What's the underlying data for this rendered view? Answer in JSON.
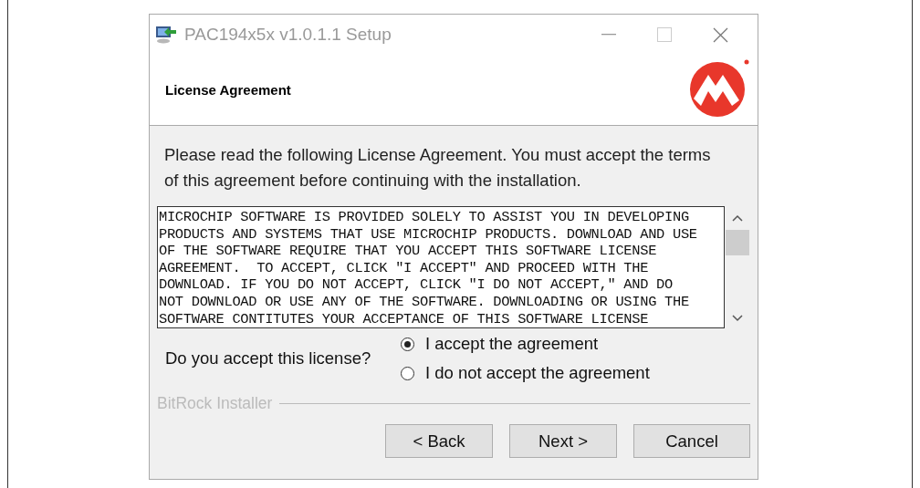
{
  "window": {
    "title": "PAC194x5x v1.0.1.1 Setup"
  },
  "header": {
    "title": "License Agreement"
  },
  "intro": "Please read the following License Agreement. You must accept the terms of this agreement before continuing with the installation.",
  "license_lines": [
    "MICROCHIP SOFTWARE IS PROVIDED SOLELY TO ASSIST YOU IN DEVELOPING",
    "PRODUCTS AND SYSTEMS THAT USE MICROCHIP PRODUCTS. DOWNLOAD AND USE",
    "OF THE SOFTWARE REQUIRE THAT YOU ACCEPT THIS SOFTWARE LICENSE",
    "AGREEMENT.  TO ACCEPT, CLICK \"I ACCEPT\" AND PROCEED WITH THE",
    "DOWNLOAD. IF YOU DO NOT ACCEPT, CLICK \"I DO NOT ACCEPT,\" AND DO",
    "NOT DOWNLOAD OR USE ANY OF THE SOFTWARE. DOWNLOADING OR USING THE",
    "SOFTWARE CONTITUTES YOUR ACCEPTANCE OF THIS SOFTWARE LICENSE"
  ],
  "question": "Do you accept this license?",
  "options": [
    {
      "label": "I accept the agreement",
      "selected": true
    },
    {
      "label": "I do not accept the agreement",
      "selected": false
    }
  ],
  "footer_label": "BitRock Installer",
  "buttons": [
    "< Back",
    "Next >",
    "Cancel"
  ]
}
